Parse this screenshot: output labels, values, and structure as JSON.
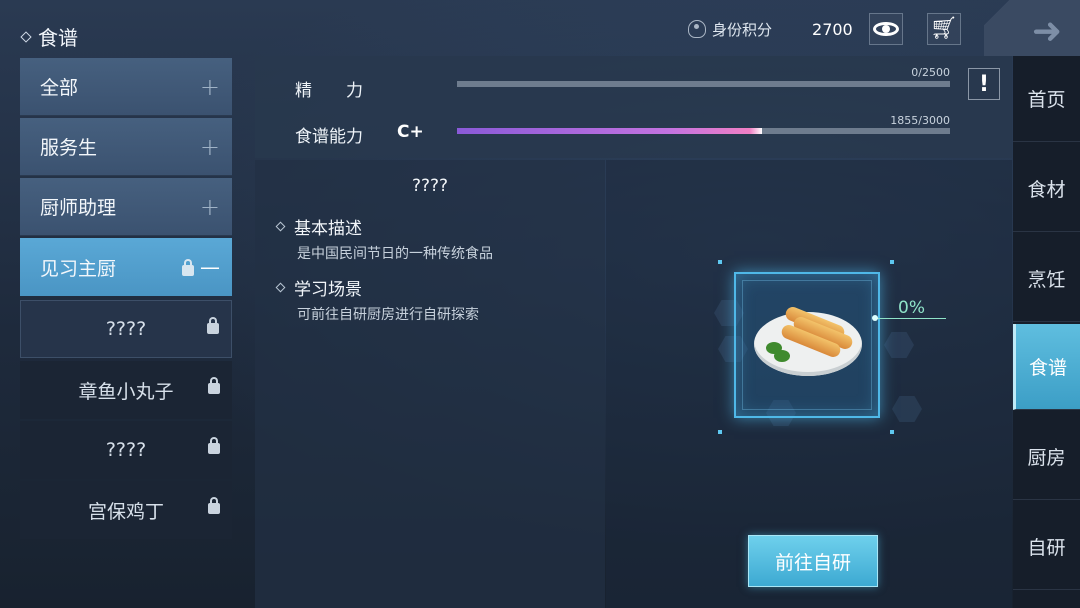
{
  "header": {
    "title": "食谱",
    "identity_label": "身份积分",
    "identity_points": "2700"
  },
  "categories": [
    {
      "label": "全部",
      "state": "collapsed"
    },
    {
      "label": "服务生",
      "state": "collapsed"
    },
    {
      "label": "厨师助理",
      "state": "collapsed"
    },
    {
      "label": "见习主厨",
      "state": "expanded"
    }
  ],
  "recipes": [
    {
      "label": "????",
      "locked": true
    },
    {
      "label": "章鱼小丸子",
      "locked": true
    },
    {
      "label": "????",
      "locked": true
    },
    {
      "label": "宫保鸡丁",
      "locked": true
    }
  ],
  "stats": {
    "energy_label": "精　　力",
    "energy_value": "0/2500",
    "energy_fraction": 0.0,
    "ability_label": "食谱能力",
    "ability_grade": "C+",
    "ability_value": "1855/3000",
    "ability_fraction": 0.618
  },
  "detail": {
    "recipe_name": "????",
    "desc_title": "基本描述",
    "desc_text": "是中国民间节日的一种传统食品",
    "scene_title": "学习场景",
    "scene_text": "可前往自研厨房进行自研探索"
  },
  "preview": {
    "progress": "0%",
    "action_label": "前往自研"
  },
  "nav": [
    {
      "label": "首页",
      "active": false
    },
    {
      "label": "食材",
      "active": false
    },
    {
      "label": "烹饪",
      "active": false
    },
    {
      "label": "食谱",
      "active": true
    },
    {
      "label": "厨房",
      "active": false
    },
    {
      "label": "自研",
      "active": false
    }
  ],
  "colors": {
    "accent": "#4a95c4",
    "progress_bar": "#c473e0",
    "percent_text": "#8fe3c8"
  }
}
